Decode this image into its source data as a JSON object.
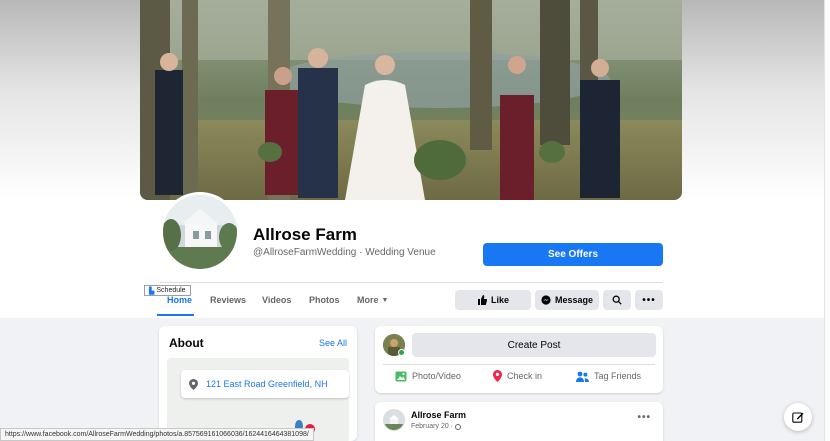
{
  "page": {
    "name": "Allrose Farm",
    "subtitle": "@AllroseFarmWedding · Wedding Venue",
    "cover_alt": "wedding-party-cover-photo",
    "see_offers_label": "See Offers"
  },
  "tooltip": {
    "label": "Schedule"
  },
  "tabs": [
    {
      "label": "Home",
      "active": true
    },
    {
      "label": "Reviews"
    },
    {
      "label": "Videos"
    },
    {
      "label": "Photos"
    },
    {
      "label": "More"
    }
  ],
  "actions": {
    "like_label": "Like",
    "message_label": "Message"
  },
  "about": {
    "title": "About",
    "see_all": "See All",
    "address": "121 East Road Greenfield, NH"
  },
  "composer": {
    "create_post_label": "Create Post",
    "photo_video_label": "Photo/Video",
    "check_in_label": "Check in",
    "tag_friends_label": "Tag Friends"
  },
  "post": {
    "author": "Allrose Farm",
    "date": "February 20 ·"
  },
  "status_bar": {
    "url": "https://www.facebook.com/AllroseFarmWedding/photos/a.857569161066036/1624416464381098/"
  },
  "colors": {
    "accent": "#1877f2",
    "background": "#f0f2f5",
    "button_gray": "#e4e6eb",
    "online": "#31a24c"
  }
}
